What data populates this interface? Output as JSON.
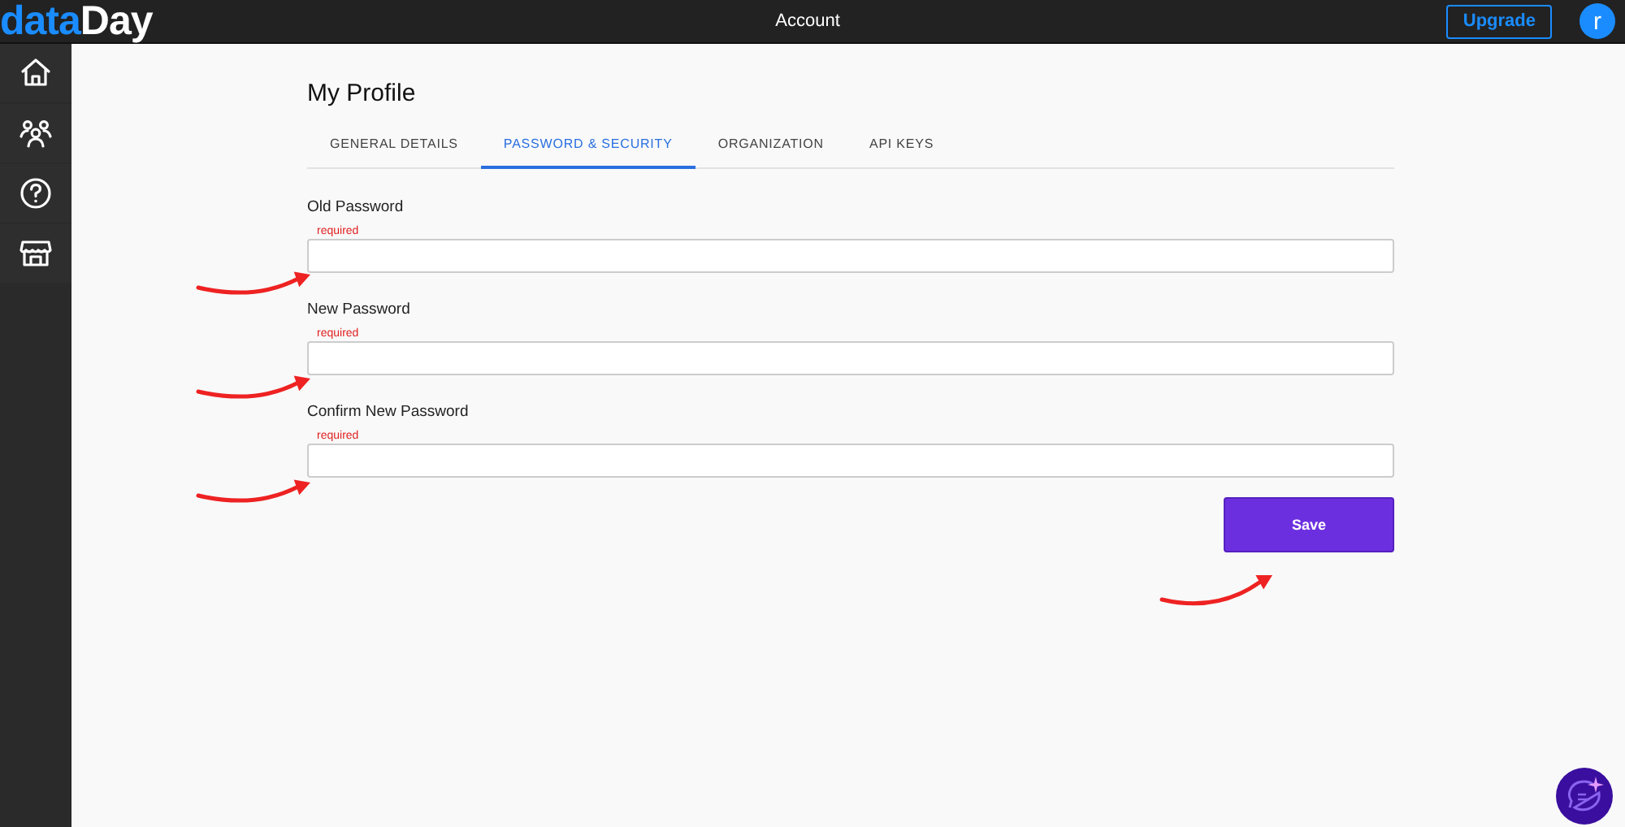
{
  "header": {
    "logo": {
      "part_1": "data",
      "part_2": "Day"
    },
    "title": "Account",
    "upgrade_button": "Upgrade",
    "avatar": "r"
  },
  "page": {
    "title": "My Profile",
    "tabs": [
      {
        "label": "GENERAL DETAILS",
        "selected": false
      },
      {
        "label": "PASSWORD & SECURITY",
        "selected": true
      },
      {
        "label": "ORGANIZATION",
        "selected": false
      },
      {
        "label": "API KEYS",
        "selected": false
      }
    ],
    "fields": [
      {
        "label": "Old Password",
        "error": "required"
      },
      {
        "label": "New Password",
        "error": "required"
      },
      {
        "label": "Confirm New Password",
        "error": "required"
      }
    ],
    "save_button": "Save"
  }
}
